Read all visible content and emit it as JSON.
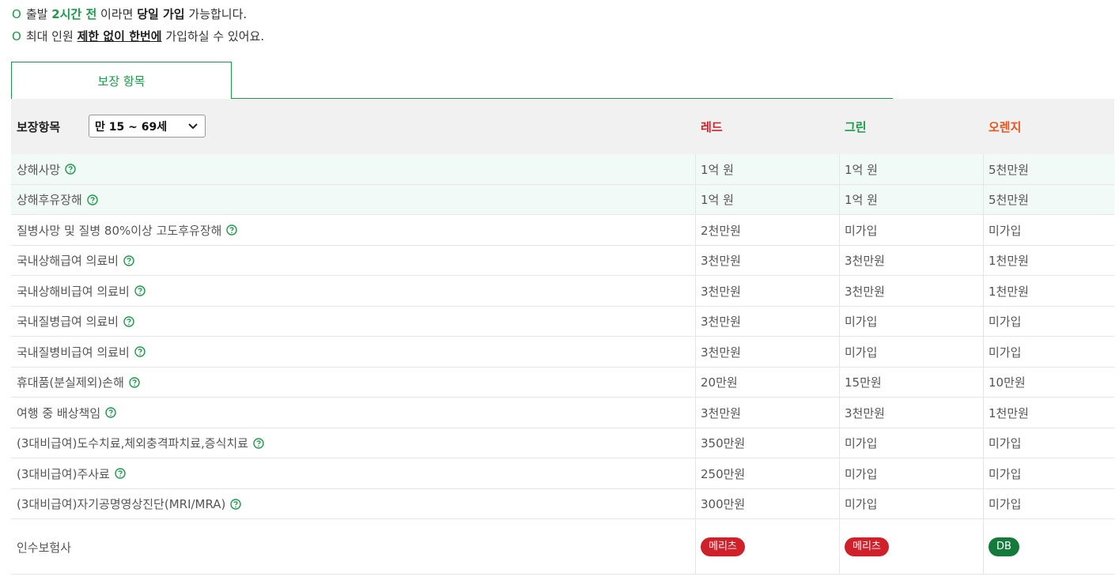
{
  "notices": [
    {
      "mark": "O",
      "p1": "출발 ",
      "hl": "2시간 전",
      "p2": " 이라면 ",
      "hl2": "당일 가입",
      "p3": " 가능합니다."
    },
    {
      "mark": "O",
      "p1": "최대 인원 ",
      "hl": "제한 없이 한번에",
      "p2": " 가입하실 수 있어요."
    }
  ],
  "tabs": {
    "active": "보장 항목"
  },
  "table": {
    "header_label": "보장항목",
    "age_select": "만 15 ~ 69세",
    "plans": [
      "레드",
      "그린",
      "오렌지"
    ],
    "plan_colors": [
      "#d0202a",
      "#1a9c4a",
      "#e8551d"
    ],
    "rows": [
      {
        "name": "상해사망",
        "values": [
          "1억 원",
          "1억 원",
          "5천만원"
        ]
      },
      {
        "name": "상해후유장해",
        "values": [
          "1억 원",
          "1억 원",
          "5천만원"
        ]
      },
      {
        "name": "질병사망 및 질병 80%이상 고도후유장해",
        "values": [
          "2천만원",
          "미가입",
          "미가입"
        ]
      },
      {
        "name": "국내상해급여 의료비",
        "values": [
          "3천만원",
          "3천만원",
          "1천만원"
        ]
      },
      {
        "name": "국내상해비급여 의료비",
        "values": [
          "3천만원",
          "3천만원",
          "1천만원"
        ]
      },
      {
        "name": "국내질병급여 의료비",
        "values": [
          "3천만원",
          "미가입",
          "미가입"
        ]
      },
      {
        "name": "국내질병비급여 의료비",
        "values": [
          "3천만원",
          "미가입",
          "미가입"
        ]
      },
      {
        "name": "휴대품(분실제외)손해",
        "values": [
          "20만원",
          "15만원",
          "10만원"
        ]
      },
      {
        "name": "여행 중 배상책임",
        "values": [
          "3천만원",
          "3천만원",
          "1천만원"
        ]
      },
      {
        "name": "(3대비급여)도수치료,체외충격파치료,증식치료",
        "values": [
          "350만원",
          "미가입",
          "미가입"
        ]
      },
      {
        "name": "(3대비급여)주사료",
        "values": [
          "250만원",
          "미가입",
          "미가입"
        ]
      },
      {
        "name": "(3대비급여)자기공명영상진단(MRI/MRA)",
        "values": [
          "300만원",
          "미가입",
          "미가입"
        ]
      }
    ],
    "insurer_label": "인수보험사",
    "insurers": [
      "메리츠",
      "메리츠",
      "DB"
    ]
  }
}
